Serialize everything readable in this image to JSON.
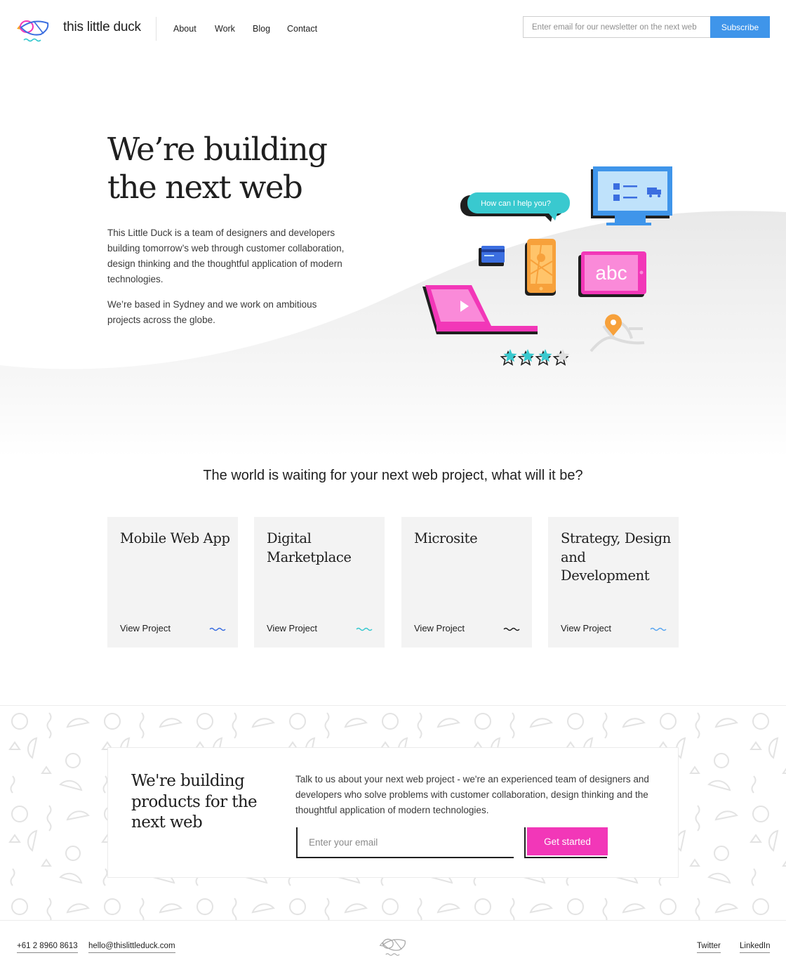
{
  "header": {
    "brand": "this little duck",
    "nav": [
      "About",
      "Work",
      "Blog",
      "Contact"
    ],
    "newsletter_placeholder": "Enter email for our newsletter on the next web",
    "subscribe_label": "Subscribe"
  },
  "hero": {
    "title_line1": "We’re building",
    "title_line2": "the next web",
    "paragraph1": "This Little Duck is a team of designers and developers building tomorrow’s web through customer collaboration, design thinking and the thoughtful application of modern technologies.",
    "paragraph2": "We’re based in Sydney and we work on ambitious projects across the globe.",
    "illustration": {
      "chat_bubble": "How can I help you?",
      "tablet_text": "abc",
      "rating_filled": 3,
      "rating_total": 4
    }
  },
  "projects": {
    "heading": "The world is waiting for your next web project, what will it be?",
    "cards": [
      {
        "title": "Mobile Web App",
        "link": "View Project",
        "wave_color": "#3b6ee0"
      },
      {
        "title": "Digital Marketplace",
        "link": "View Project",
        "wave_color": "#39c9cf"
      },
      {
        "title": "Microsite",
        "link": "View Project",
        "wave_color": "#1f1f1f"
      },
      {
        "title": "Strategy, Design and Development",
        "link": "View Project",
        "wave_color": "#5aa6f0"
      }
    ]
  },
  "cta": {
    "title": "We're building products for the next web",
    "paragraph": "Talk to us about your next web project - we're an experienced team of designers and developers who solve problems with customer collaboration, design thinking and the thoughtful application of modern technologies.",
    "email_placeholder": "Enter your email",
    "button_label": "Get started"
  },
  "footer": {
    "phone": "+61 2 8960 8613",
    "email": "hello@thislittleduck.com",
    "twitter": "Twitter",
    "linkedin": "LinkedIn"
  },
  "colors": {
    "accent_blue": "#3f95ea",
    "accent_pink": "#f237b8",
    "teal": "#39c9cf"
  }
}
